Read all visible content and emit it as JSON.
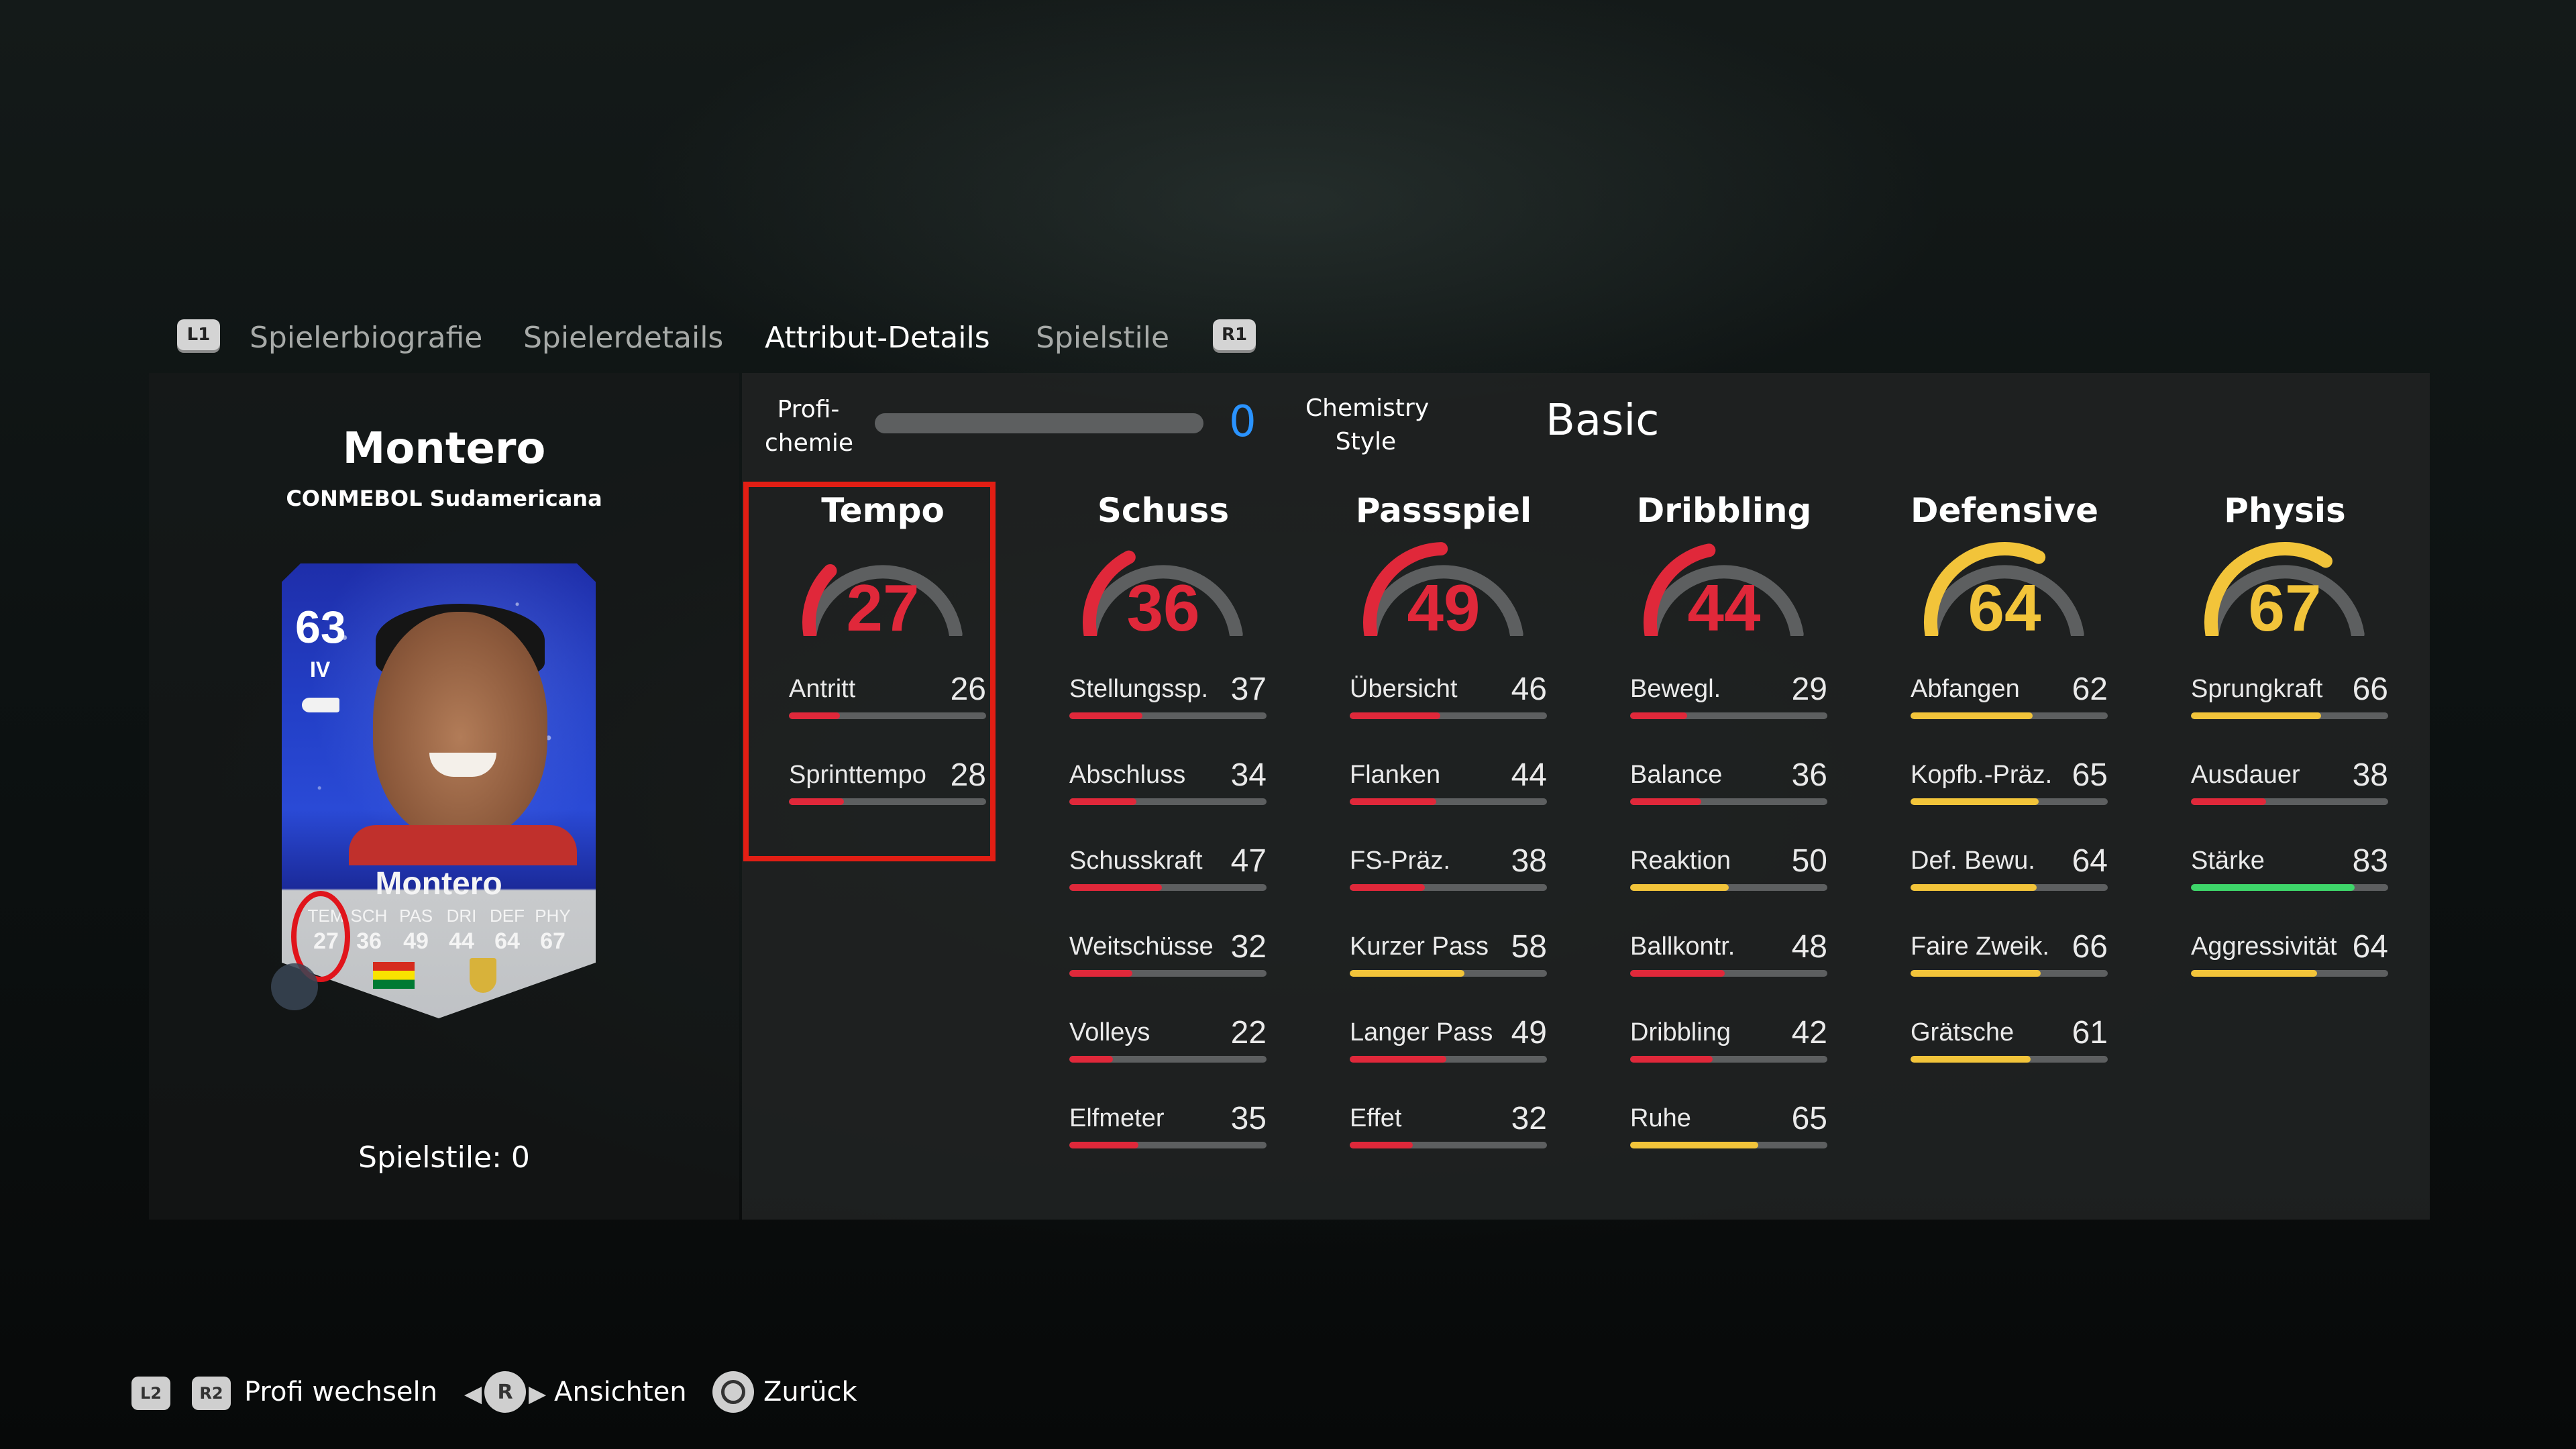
{
  "nav": {
    "left_button": "L1",
    "right_button": "R1",
    "tabs": [
      {
        "label": "Spielerbiografie",
        "active": false
      },
      {
        "label": "Spielerdetails",
        "active": false
      },
      {
        "label": "Attribut-Details",
        "active": true
      },
      {
        "label": "Spielstile",
        "active": false
      }
    ]
  },
  "player": {
    "name": "Montero",
    "league": "CONMEBOL Sudamericana",
    "playstyles_text": "Spielstile: 0",
    "card": {
      "rating": "63",
      "position": "IV",
      "name": "Montero",
      "stat_labels": [
        "TEM",
        "SCH",
        "PAS",
        "DRI",
        "DEF",
        "PHY"
      ],
      "stat_values": [
        "27",
        "36",
        "49",
        "44",
        "64",
        "67"
      ]
    }
  },
  "chemistry": {
    "profi_label_line1": "Profi-",
    "profi_label_line2": "chemie",
    "profi_value": "0",
    "style_label_line1": "Chemistry",
    "style_label_line2": "Style",
    "style_value": "Basic"
  },
  "colors": {
    "red": "#e0283a",
    "yellow": "#f2c43a",
    "green": "#3ed66a",
    "track": "#5d5f60",
    "chem_blue": "#2a93ff",
    "highlight_red": "#e21e14"
  },
  "categories": [
    {
      "name": "Tempo",
      "value": 27,
      "color": "red",
      "highlighted": true,
      "attributes": [
        {
          "name": "Antritt",
          "value": 26
        },
        {
          "name": "Sprinttempo",
          "value": 28
        }
      ]
    },
    {
      "name": "Schuss",
      "value": 36,
      "color": "red",
      "highlighted": false,
      "attributes": [
        {
          "name": "Stellungssp.",
          "value": 37
        },
        {
          "name": "Abschluss",
          "value": 34
        },
        {
          "name": "Schusskraft",
          "value": 47
        },
        {
          "name": "Weitschüsse",
          "value": 32
        },
        {
          "name": "Volleys",
          "value": 22
        },
        {
          "name": "Elfmeter",
          "value": 35
        }
      ]
    },
    {
      "name": "Passspiel",
      "value": 49,
      "color": "red",
      "highlighted": false,
      "attributes": [
        {
          "name": "Übersicht",
          "value": 46
        },
        {
          "name": "Flanken",
          "value": 44
        },
        {
          "name": "FS-Präz.",
          "value": 38
        },
        {
          "name": "Kurzer Pass",
          "value": 58
        },
        {
          "name": "Langer Pass",
          "value": 49
        },
        {
          "name": "Effet",
          "value": 32
        }
      ]
    },
    {
      "name": "Dribbling",
      "value": 44,
      "color": "red",
      "highlighted": false,
      "attributes": [
        {
          "name": "Bewegl.",
          "value": 29
        },
        {
          "name": "Balance",
          "value": 36
        },
        {
          "name": "Reaktion",
          "value": 50
        },
        {
          "name": "Ballkontr.",
          "value": 48
        },
        {
          "name": "Dribbling",
          "value": 42
        },
        {
          "name": "Ruhe",
          "value": 65
        }
      ]
    },
    {
      "name": "Defensive",
      "value": 64,
      "color": "yellow",
      "highlighted": false,
      "attributes": [
        {
          "name": "Abfangen",
          "value": 62
        },
        {
          "name": "Kopfb.-Präz.",
          "value": 65
        },
        {
          "name": "Def. Bewu.",
          "value": 64
        },
        {
          "name": "Faire Zweik.",
          "value": 66
        },
        {
          "name": "Grätsche",
          "value": 61
        }
      ]
    },
    {
      "name": "Physis",
      "value": 67,
      "color": "yellow",
      "highlighted": false,
      "attributes": [
        {
          "name": "Sprungkraft",
          "value": 66
        },
        {
          "name": "Ausdauer",
          "value": 38
        },
        {
          "name": "Stärke",
          "value": 83
        },
        {
          "name": "Aggressivität",
          "value": 64
        }
      ]
    }
  ],
  "footer": {
    "l2": "L2",
    "r2": "R2",
    "switch_label": "Profi wechseln",
    "r_stick": "R",
    "views_label": "Ansichten",
    "back_label": "Zurück"
  }
}
